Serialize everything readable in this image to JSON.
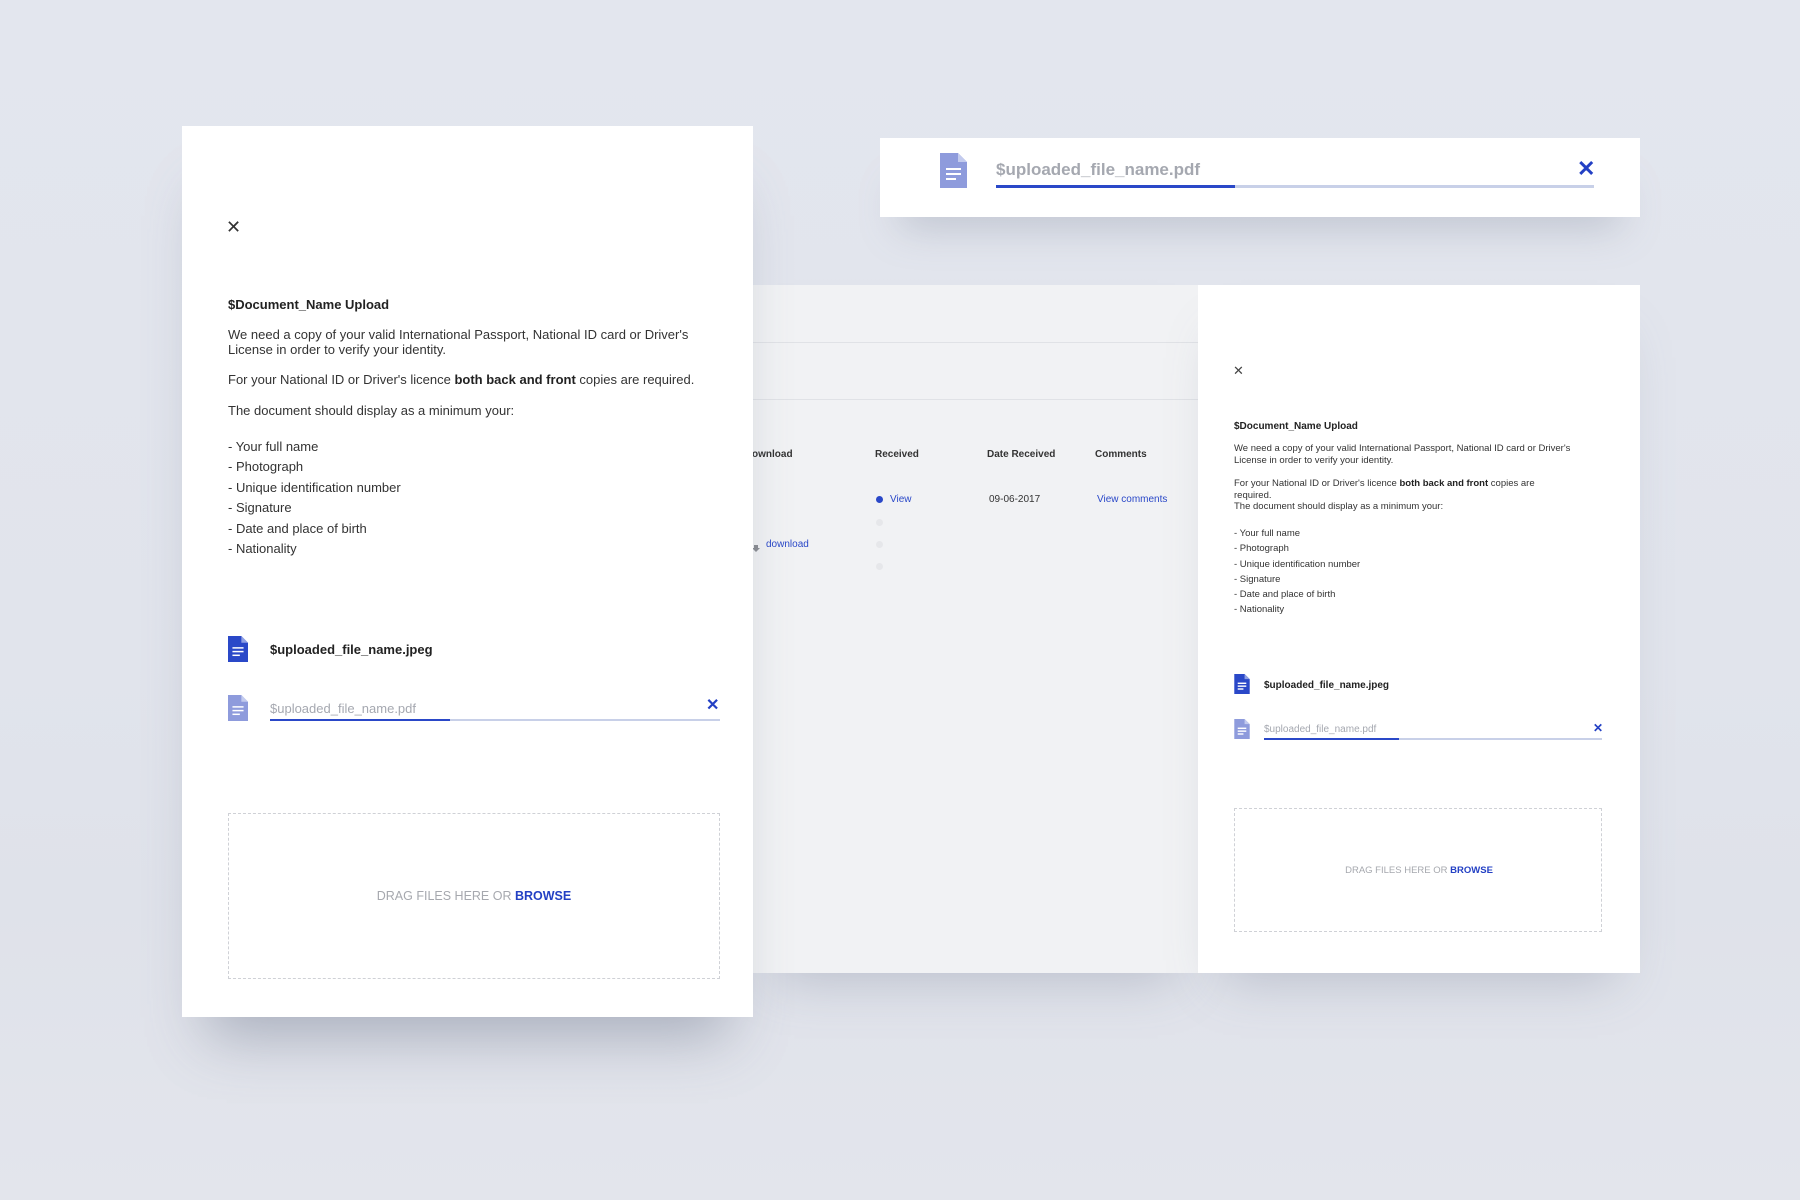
{
  "colors": {
    "accent": "#2340c4",
    "doc_icon_solid": "#2a48c8",
    "doc_icon_muted": "#8e9bdc",
    "placeholder_text": "#a5a8b0",
    "progress_track": "#c8d0e8"
  },
  "floating_upload": {
    "file_name": "$uploaded_file_name.pdf",
    "progress_fraction": 0.4,
    "close_icon": "close-icon"
  },
  "documents_table": {
    "headers": {
      "download": "ownload",
      "received": "Received",
      "date_received": "Date Received",
      "comments": "Comments"
    },
    "rows": [
      {
        "received": "View",
        "received_status": "filled",
        "date_received": "09-06-2017",
        "comments": "View comments",
        "download": ""
      },
      {
        "received": "",
        "received_status": "empty",
        "date_received": "",
        "comments": "",
        "download": ""
      },
      {
        "received": "",
        "received_status": "empty",
        "date_received": "",
        "comments": "",
        "download": "download"
      },
      {
        "received": "",
        "received_status": "empty",
        "date_received": "",
        "comments": "",
        "download": ""
      }
    ]
  },
  "upload_modal": {
    "close_icon": "close-icon",
    "title": "$Document_Name Upload",
    "intro": "We need a copy of your valid International Passport, National ID card or Driver's License in order to verify your identity.",
    "requirement_before": "For your National ID or Driver's licence ",
    "requirement_bold": "both back and front",
    "requirement_after": " copies are required.",
    "minimum_text": "The document should display as a minimum your:",
    "requirements": [
      "- Your full name",
      "- Photograph",
      "- Unique identification number",
      "- Signature",
      "- Date and place of birth",
      "- Nationality"
    ],
    "uploaded_file": "$uploaded_file_name.jpeg",
    "uploading_file": "$uploaded_file_name.pdf",
    "upload_progress_fraction": 0.4,
    "drop_text": "DRAG FILES HERE OR ",
    "browse_label": "BROWSE"
  }
}
